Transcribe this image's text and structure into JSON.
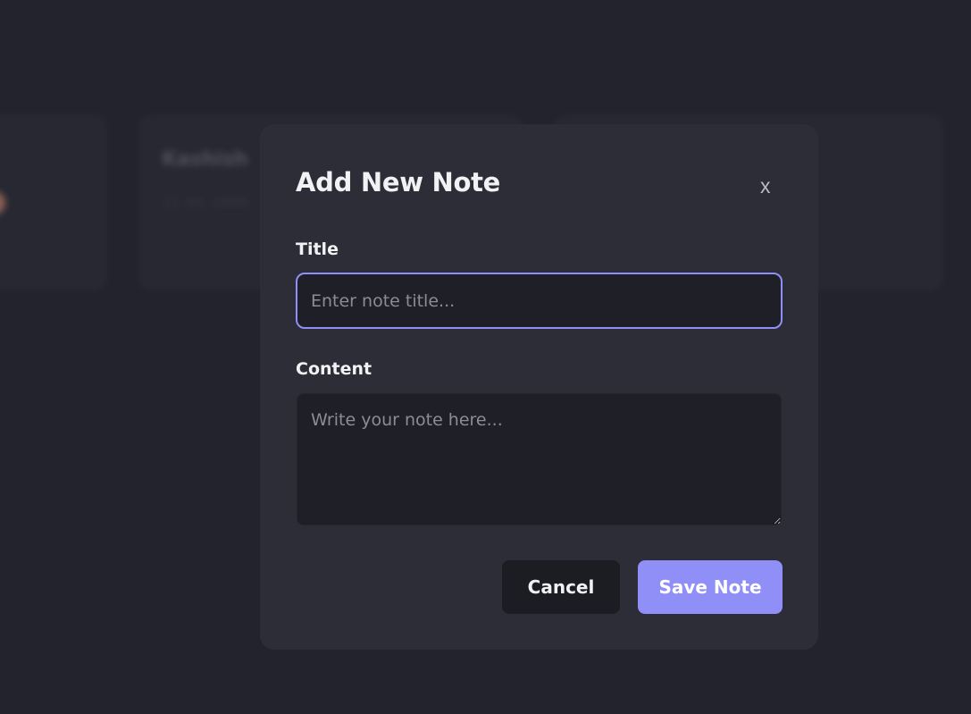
{
  "background": {
    "cards": [
      {
        "title": "",
        "date": ""
      },
      {
        "title": "Kashish",
        "date": "21-01-2005"
      },
      {
        "title": "",
        "date": ""
      }
    ]
  },
  "modal": {
    "title": "Add New Note",
    "close_label": "x",
    "title_field": {
      "label": "Title",
      "value": "",
      "placeholder": "Enter note title..."
    },
    "content_field": {
      "label": "Content",
      "value": "",
      "placeholder": "Write your note here..."
    },
    "cancel_label": "Cancel",
    "save_label": "Save Note"
  },
  "colors": {
    "accent": "#8f8ff7",
    "modal_bg": "#2c2d37",
    "page_bg": "#22232d",
    "input_bg": "#1f1f27"
  }
}
